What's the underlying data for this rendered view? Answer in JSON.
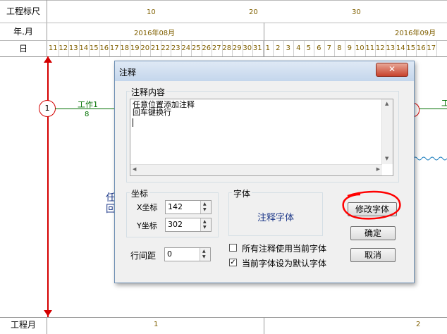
{
  "header": {
    "row1_label": "工程标尺",
    "row2_label": "年.月",
    "row3_label": "日",
    "ruler_marks": [
      "10",
      "20",
      "30"
    ],
    "month_aug": "2016年08月",
    "month_sep": "2016年09月",
    "days_aug": [
      "11",
      "12",
      "13",
      "14",
      "15",
      "16",
      "17",
      "18",
      "19",
      "20",
      "21",
      "22",
      "23",
      "24",
      "25",
      "26",
      "27",
      "28",
      "29",
      "30",
      "31"
    ],
    "days_sep": [
      "1",
      "2",
      "3",
      "4",
      "5",
      "6",
      "7",
      "8",
      "9",
      "10",
      "11",
      "12",
      "13",
      "14",
      "15",
      "16",
      "17"
    ]
  },
  "canvas": {
    "node1": "1",
    "task_name": "工作1",
    "task_duration": "8",
    "partial_text_1": "任",
    "partial_text_2": "回",
    "partial_right": "工"
  },
  "footer": {
    "label": "工程月",
    "month1": "1",
    "month2": "2"
  },
  "dialog": {
    "title": "注释",
    "content_group": "注释内容",
    "content_lines": [
      "任意位置添加注释",
      "回车键换行"
    ],
    "coord_group": "坐标",
    "x_label": "X坐标",
    "x_value": "142",
    "y_label": "Y坐标",
    "y_value": "302",
    "font_group": "字体",
    "font_sample": "注释字体",
    "modify_font": "修改字体",
    "ok": "确定",
    "cancel": "取消",
    "line_spacing_label": "行间距",
    "line_spacing_value": "0",
    "check_all": "所有注释使用当前字体",
    "check_default": "当前字体设为默认字体",
    "check_all_state": false,
    "check_default_state": true
  },
  "colors": {
    "accent_red": "#d40000",
    "task_green": "#007000",
    "header_text": "#806000",
    "font_sample": "#1f3a8a"
  }
}
